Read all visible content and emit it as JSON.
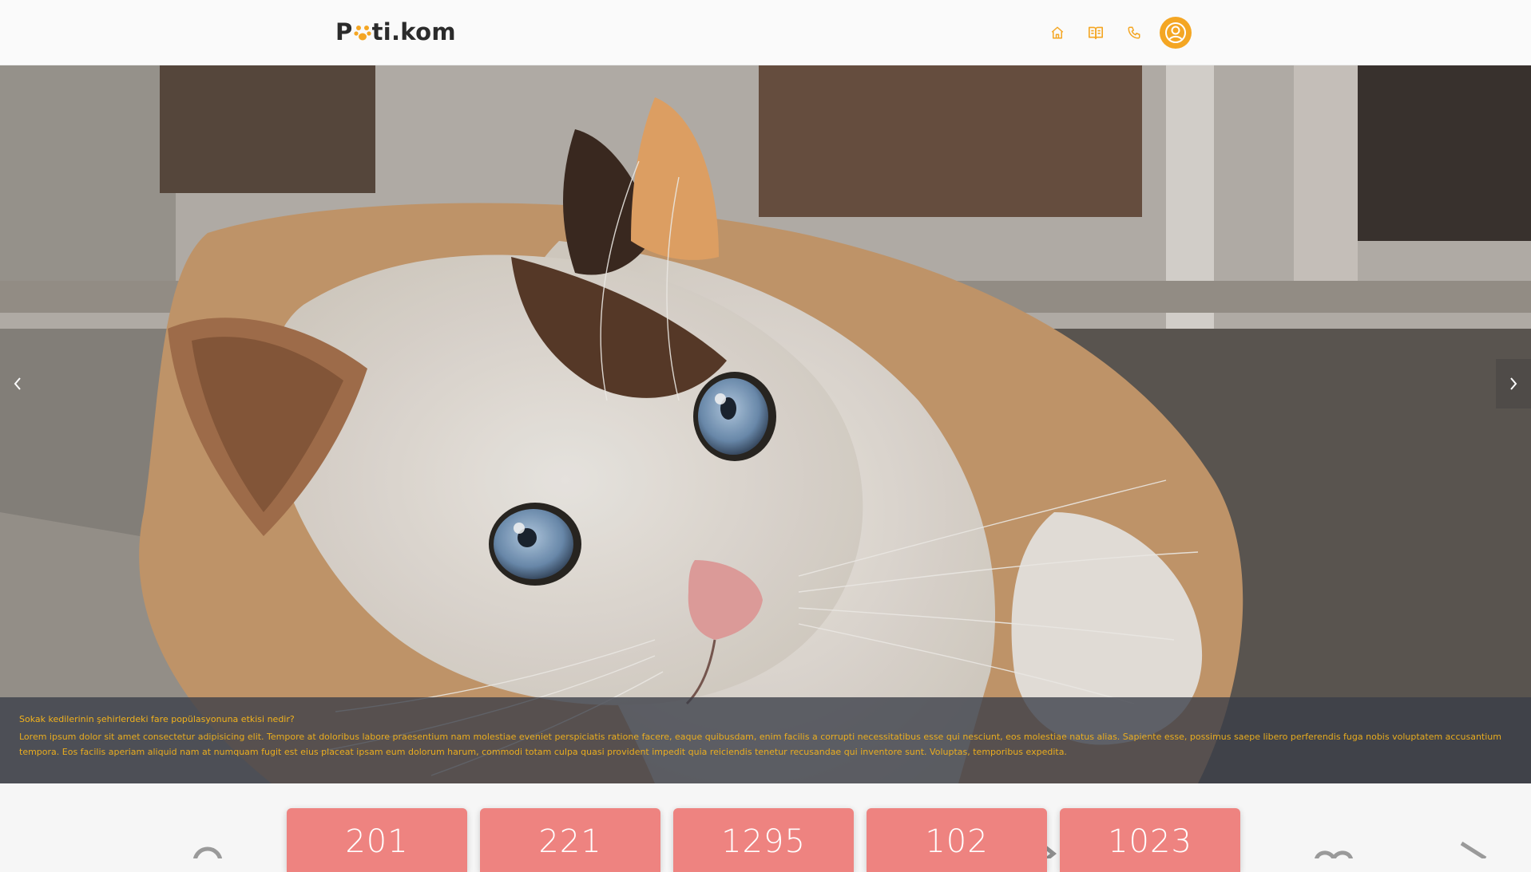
{
  "header": {
    "logo_prefix": "P",
    "logo_suffix": "ti.kom",
    "nav": [
      {
        "icon": "home-icon"
      },
      {
        "icon": "book-icon"
      },
      {
        "icon": "phone-icon"
      }
    ],
    "profile_icon": "user-icon",
    "accent_color": "#f4a623"
  },
  "hero": {
    "caption_title": "Sokak kedilerinin şehirlerdeki fare popülasyonuna etkisi nedir?",
    "caption_text": "Lorem ipsum dolor sit amet consectetur adipisicing elit. Tempore at doloribus labore praesentium nam molestiae eveniet perspiciatis ratione facere, eaque quibusdam, enim facilis a corrupti necessitatibus esse qui nesciunt, eos molestiae natus alias. Sapiente esse, possimus saepe libero perferendis fuga nobis voluptatem accusantium tempora. Eos facilis aperiam aliquid nam at numquam fugit est eius placeat ipsam eum dolorum harum, commodi totam culpa quasi provident impedit quia reiciendis tenetur recusandae qui inventore sunt. Voluptas, temporibus expedita.",
    "caption_color": "#f2b21c"
  },
  "stats": {
    "values": [
      "201",
      "221",
      "1295",
      "102",
      "1023"
    ],
    "card_color": "#ee8380"
  }
}
